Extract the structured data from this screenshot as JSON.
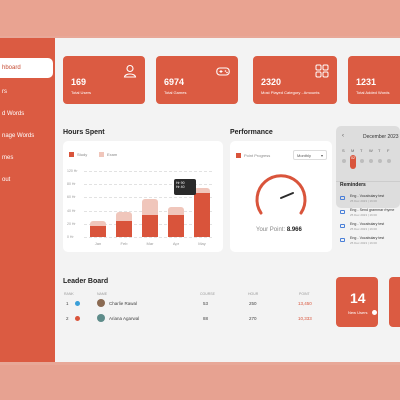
{
  "sidebar": {
    "items": [
      {
        "label": "hboard",
        "active": true
      },
      {
        "label": "rs",
        "active": false
      },
      {
        "label": "d Words",
        "active": false
      },
      {
        "label": "nage Words",
        "active": false
      },
      {
        "label": "mes",
        "active": false
      },
      {
        "label": "out",
        "active": false
      }
    ]
  },
  "stats": [
    {
      "value": "169",
      "label": "Total Users",
      "icon": "user-icon"
    },
    {
      "value": "6974",
      "label": "Total Games",
      "icon": "gamepad-icon"
    },
    {
      "value": "2320",
      "label": "Most Played Category - Amounts",
      "icon": "grid-icon"
    },
    {
      "value": "1231",
      "label": "Total Added Words",
      "icon": ""
    }
  ],
  "hours": {
    "title": "Hours Spent",
    "legend": [
      "Study",
      "Exam"
    ],
    "yticks": [
      "120 Hr",
      "80 Hr",
      "60 Hr",
      "40 Hr",
      "20 Hr",
      "0 Hr"
    ],
    "tooltip": [
      "Hr 90",
      "Hr 40"
    ],
    "chart_data": {
      "type": "bar",
      "categories": [
        "Jan",
        "Feb",
        "Mar",
        "Apr",
        "May"
      ],
      "series": [
        {
          "name": "Study",
          "values": [
            20,
            30,
            40,
            40,
            80
          ]
        },
        {
          "name": "Exam",
          "values": [
            10,
            15,
            30,
            15,
            10
          ]
        }
      ],
      "ylim": [
        0,
        120
      ],
      "colors": [
        "#d9543b",
        "#f0c6bb"
      ]
    }
  },
  "performance": {
    "title": "Performance",
    "legend": "Point Progress",
    "dropdown": "Monthly",
    "points_label": "Your Point:",
    "points_value": "8.966"
  },
  "calendar": {
    "title": "December 2023",
    "days": [
      "S",
      "M",
      "T",
      "W",
      "T",
      "F"
    ],
    "dates": [
      "",
      "02",
      "",
      "",
      "",
      ""
    ]
  },
  "reminders": {
    "title": "Reminders",
    "items": [
      {
        "text": "Eng - Vocabulary test",
        "sub": "25 Dec 2023 | 16:00"
      },
      {
        "text": "Eng - Send grammar rhyme",
        "sub": "25 Dec 2023 | 16:00"
      },
      {
        "text": "Eng - Vocabulary test",
        "sub": "25 Dec 2023 | 16:00"
      },
      {
        "text": "Eng - Vocabulary test",
        "sub": "25 Dec 2023 | 16:00"
      }
    ]
  },
  "leaderboard": {
    "title": "Leader Board",
    "headers": [
      "RANK",
      "NAME",
      "COURSE",
      "HOUR",
      "POINT"
    ],
    "rows": [
      {
        "rank": "1",
        "name": "Charlie Rawal",
        "course": "53",
        "hour": "250",
        "point": "13,450"
      },
      {
        "rank": "2",
        "name": "Ariana Agarwal",
        "course": "88",
        "hour": "270",
        "point": "10,333"
      }
    ]
  },
  "tiles": [
    {
      "value": "14",
      "label": "New Users"
    }
  ],
  "colors": {
    "accent": "#db5b42",
    "light": "#f0c6bb"
  }
}
